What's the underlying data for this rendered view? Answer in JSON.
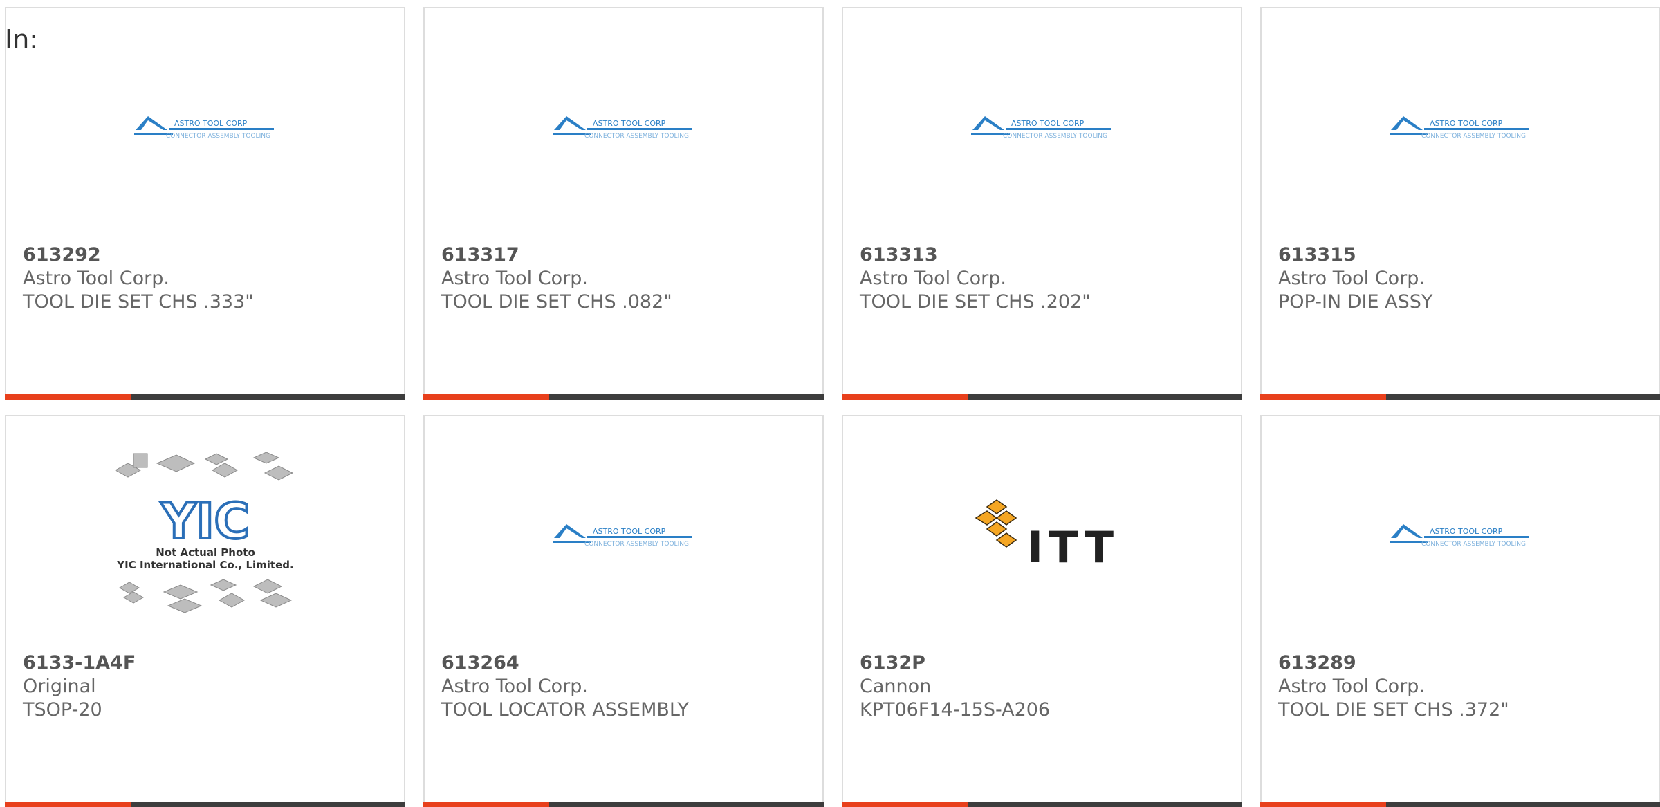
{
  "page": {
    "in_label": "In:"
  },
  "colors": {
    "accent": "#e8401c",
    "bar": "#3d3d3d",
    "astro_blue": "#2a7fc6",
    "itt_orange": "#f5a623",
    "yic_blue": "#2b6fb8"
  },
  "logos": {
    "astro_line1": "ASTRO TOOL CORP",
    "astro_line2": "CONNECTOR ASSEMBLY TOOLING",
    "itt_text": "ITT",
    "yic_mark": "YIC",
    "yic_line1": "Not Actual Photo",
    "yic_line2": "YIC International Co., Limited."
  },
  "products": [
    {
      "part_number": "613292",
      "manufacturer": "Astro Tool Corp.",
      "description": "TOOL DIE SET CHS .333\"",
      "image": "astro-logo"
    },
    {
      "part_number": "613317",
      "manufacturer": "Astro Tool Corp.",
      "description": "TOOL DIE SET CHS .082\"",
      "image": "astro-logo"
    },
    {
      "part_number": "613313",
      "manufacturer": "Astro Tool Corp.",
      "description": "TOOL DIE SET CHS .202\"",
      "image": "astro-logo"
    },
    {
      "part_number": "613315",
      "manufacturer": "Astro Tool Corp.",
      "description": "POP-IN DIE ASSY",
      "image": "astro-logo"
    },
    {
      "part_number": "6133-1A4F",
      "manufacturer": "Original",
      "description": "TSOP-20",
      "image": "yic-placeholder"
    },
    {
      "part_number": "613264",
      "manufacturer": "Astro Tool Corp.",
      "description": "TOOL LOCATOR ASSEMBLY",
      "image": "astro-logo"
    },
    {
      "part_number": "6132P",
      "manufacturer": "Cannon",
      "description": "KPT06F14-15S-A206",
      "image": "itt-logo"
    },
    {
      "part_number": "613289",
      "manufacturer": "Astro Tool Corp.",
      "description": "TOOL DIE SET CHS .372\"",
      "image": "astro-logo"
    }
  ]
}
